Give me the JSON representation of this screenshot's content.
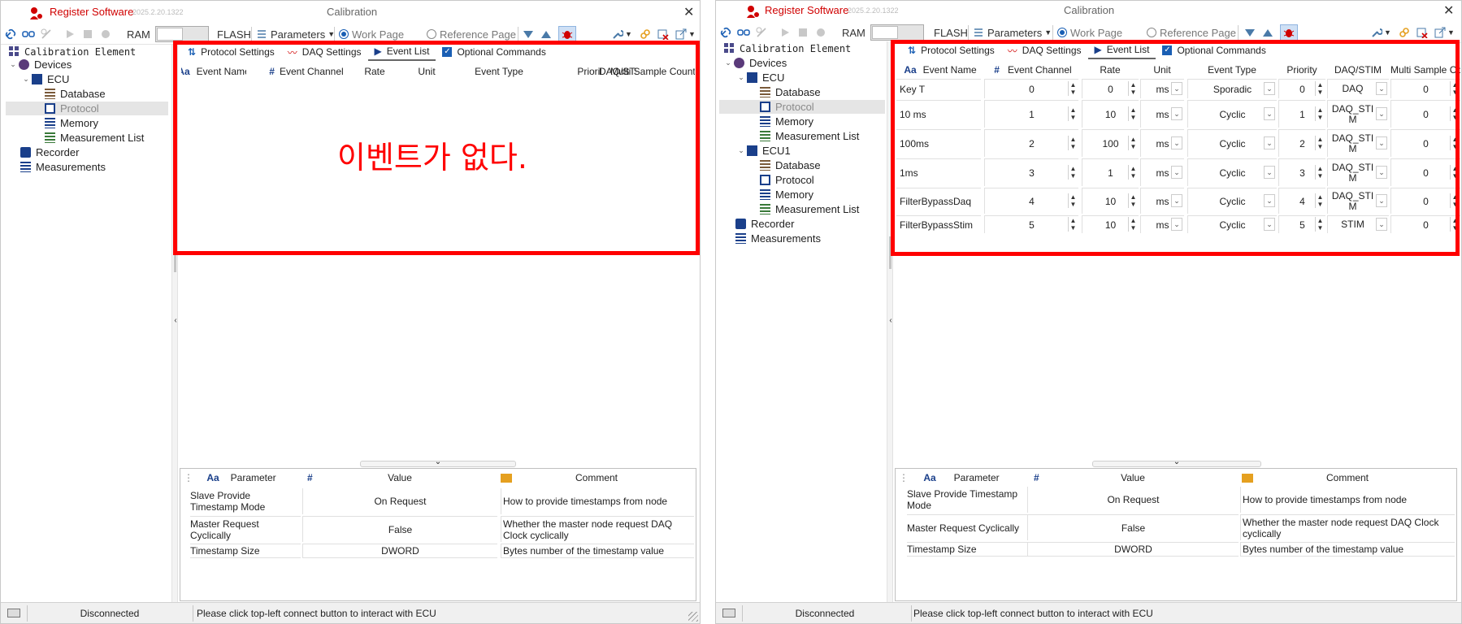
{
  "app": {
    "name": "Register Software",
    "version": "2025.2.20.1322",
    "window_title": "Calibration"
  },
  "toolbar": {
    "ram_label": "RAM",
    "flash_label": "FLASH",
    "parameters_label": "Parameters",
    "work_page_label": "Work Page",
    "reference_page_label": "Reference Page"
  },
  "tree_left": {
    "header": "Calibration Element",
    "devices": "Devices",
    "ecu": "ECU",
    "database": "Database",
    "protocol": "Protocol",
    "memory": "Memory",
    "measurement_list": "Measurement List",
    "recorder": "Recorder",
    "measurements": "Measurements"
  },
  "tree_right": {
    "header": "Calibration Element",
    "devices": "Devices",
    "ecu": "ECU",
    "ecu1": "ECU1",
    "database": "Database",
    "protocol": "Protocol",
    "memory": "Memory",
    "measurement_list": "Measurement List",
    "recorder": "Recorder",
    "measurements": "Measurements"
  },
  "tabs": {
    "protocol_settings": "Protocol Settings",
    "daq_settings": "DAQ Settings",
    "event_list": "Event List",
    "optional_commands": "Optional Commands"
  },
  "event_columns": {
    "name": "Event Name",
    "channel": "Event Channel",
    "rate": "Rate",
    "unit": "Unit",
    "type": "Event Type",
    "priority": "Priority",
    "daq_stim": "DAQ/STIM",
    "multi": "Multi Sample Count"
  },
  "empty_message": "이벤트가 없다.",
  "events": [
    {
      "name": "Key T",
      "channel": "0",
      "rate": "0",
      "unit": "ms",
      "type": "Sporadic",
      "priority": "0",
      "daq_stim": "DAQ",
      "multi": "0"
    },
    {
      "name": "10 ms",
      "channel": "1",
      "rate": "10",
      "unit": "ms",
      "type": "Cyclic",
      "priority": "1",
      "daq_stim": "DAQ_STIM",
      "multi": "0"
    },
    {
      "name": "100ms",
      "channel": "2",
      "rate": "100",
      "unit": "ms",
      "type": "Cyclic",
      "priority": "2",
      "daq_stim": "DAQ_STIM",
      "multi": "0"
    },
    {
      "name": "1ms",
      "channel": "3",
      "rate": "1",
      "unit": "ms",
      "type": "Cyclic",
      "priority": "3",
      "daq_stim": "DAQ_STIM",
      "multi": "0"
    },
    {
      "name": "FilterBypassDaq",
      "channel": "4",
      "rate": "10",
      "unit": "ms",
      "type": "Cyclic",
      "priority": "4",
      "daq_stim": "DAQ_STIM",
      "multi": "0"
    },
    {
      "name": "FilterBypassStim",
      "channel": "5",
      "rate": "10",
      "unit": "ms",
      "type": "Cyclic",
      "priority": "5",
      "daq_stim": "STIM",
      "multi": "0"
    }
  ],
  "param_columns": {
    "parameter": "Parameter",
    "value": "Value",
    "comment": "Comment"
  },
  "params": [
    {
      "parameter": "Slave Provide Timestamp Mode",
      "value": "On Request",
      "comment": "How to provide timestamps from node"
    },
    {
      "parameter": "Master Request Cyclically",
      "value": "False",
      "comment": "Whether the master node request DAQ Clock cyclically"
    },
    {
      "parameter": "Timestamp Size",
      "value": "DWORD",
      "comment": "Bytes number of the timestamp value"
    }
  ],
  "status": {
    "connection": "Disconnected",
    "message": "Please click top-left connect button to interact with ECU"
  },
  "colors": {
    "brand_red": "#d00000",
    "highlight_red": "#ff0000",
    "accent_blue": "#1a5fb4"
  }
}
